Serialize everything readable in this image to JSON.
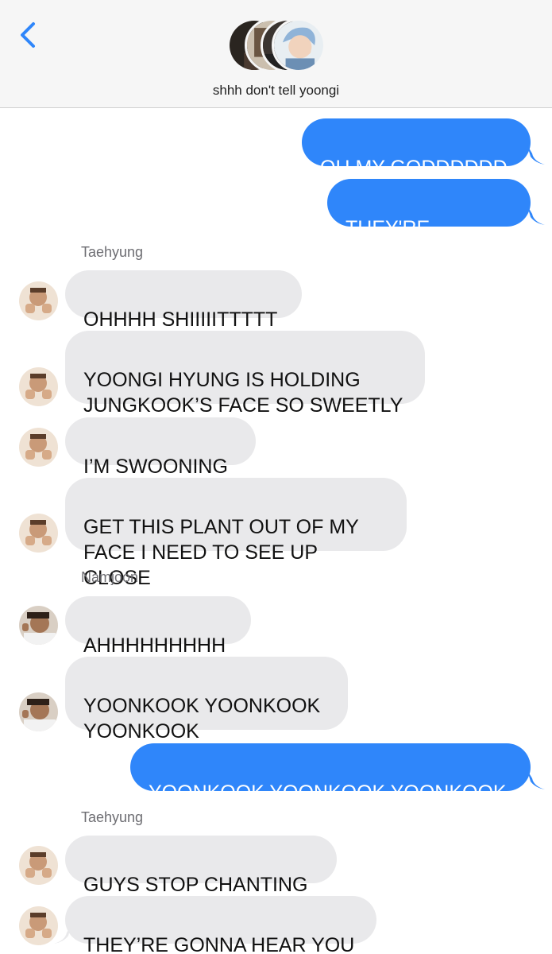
{
  "header": {
    "group_name": "shhh don't tell yoongi",
    "back_icon": "chevron-left-icon"
  },
  "colors": {
    "outgoing_bubble": "#2f86fa",
    "incoming_bubble": "#e9e9eb",
    "header_bg": "#f6f6f6",
    "back_icon": "#2f86fa"
  },
  "messages": [
    {
      "dir": "out",
      "text": "OH MY GODDDDDD"
    },
    {
      "dir": "out",
      "text": "THEY'RE KISSING"
    },
    {
      "dir": "label",
      "text": "Taehyung"
    },
    {
      "dir": "in",
      "sender": "Taehyung",
      "text": "OHHHH SHIIIIITTTTT"
    },
    {
      "dir": "in",
      "sender": "Taehyung",
      "text": "YOONGI HYUNG IS HOLDING\nJUNGKOOK’S FACE SO SWEETLY"
    },
    {
      "dir": "in",
      "sender": "Taehyung",
      "text": "I’M SWOONING"
    },
    {
      "dir": "in",
      "sender": "Taehyung",
      "text": "GET THIS PLANT OUT OF MY\nFACE I NEED TO SEE UP CLOSE"
    },
    {
      "dir": "label",
      "text": "Namjoon"
    },
    {
      "dir": "in",
      "sender": "Namjoon",
      "text": "AHHHHHHHHH"
    },
    {
      "dir": "in",
      "sender": "Namjoon",
      "text": "YOONKOOK YOONKOOK\nYOONKOOK"
    },
    {
      "dir": "out",
      "text": "YOONKOOK YOONKOOK YOONKOOK"
    },
    {
      "dir": "label",
      "text": "Taehyung"
    },
    {
      "dir": "in",
      "sender": "Taehyung",
      "text": "GUYS STOP CHANTING"
    },
    {
      "dir": "in",
      "sender": "Taehyung",
      "text": "THEY’RE GONNA HEAR YOU"
    }
  ]
}
